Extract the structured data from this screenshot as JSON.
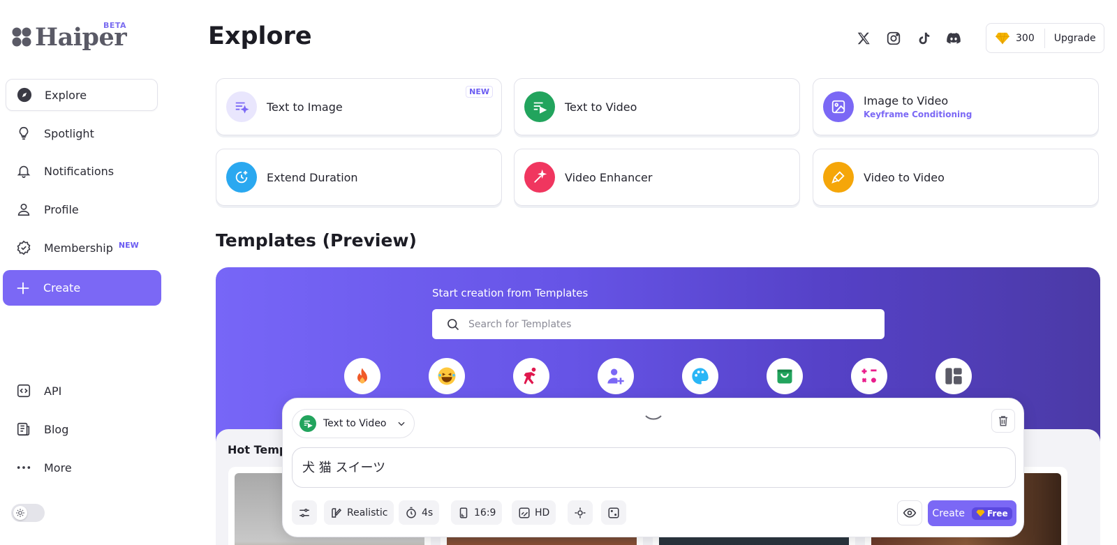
{
  "app": {
    "logo_text": "Haiper",
    "beta_label": "BETA"
  },
  "sidebar": {
    "items": [
      {
        "label": "Explore",
        "icon": "compass-icon"
      },
      {
        "label": "Spotlight",
        "icon": "lightbulb-icon"
      },
      {
        "label": "Notifications",
        "icon": "bell-icon"
      },
      {
        "label": "Profile",
        "icon": "user-icon"
      },
      {
        "label": "Membership",
        "icon": "badge-check-icon",
        "badge": "NEW"
      }
    ],
    "create_label": "Create",
    "bottom_items": [
      {
        "label": "API",
        "icon": "code-icon"
      },
      {
        "label": "Blog",
        "icon": "newspaper-icon"
      },
      {
        "label": "More",
        "icon": "dots-icon"
      }
    ]
  },
  "header": {
    "title": "Explore",
    "socials": [
      "x-icon",
      "instagram-icon",
      "tiktok-icon",
      "discord-icon"
    ],
    "credits": "300",
    "upgrade_label": "Upgrade"
  },
  "tools": [
    {
      "label": "Text to Image",
      "badge": "NEW",
      "color": "#e9e6fd"
    },
    {
      "label": "Text to Video",
      "color": "#22a45d"
    },
    {
      "label": "Image to Video",
      "sub": "Keyframe Conditioning",
      "color": "#7b68f5"
    },
    {
      "label": "Extend Duration",
      "color": "#2aa8f0"
    },
    {
      "label": "Video Enhancer",
      "color": "#f0365f"
    },
    {
      "label": "Video to Video",
      "color": "#f5a609"
    }
  ],
  "templates": {
    "title": "Templates (Preview)",
    "banner_label": "Start creation from Templates",
    "search_placeholder": "Search for Templates",
    "categories": [
      "fire-icon",
      "laughing-emoji-icon",
      "dancing-person-icon",
      "user-plus-icon",
      "palette-icon",
      "shopping-bag-icon",
      "shapes-icon",
      "layout-icon"
    ],
    "hot_title": "Hot Templ"
  },
  "composer": {
    "mode_label": "Text to Video",
    "prompt": "犬 猫 スイーツ",
    "chips": {
      "style": "Realistic",
      "duration": "4s",
      "ratio": "16:9",
      "quality": "HD"
    },
    "create_label": "Create",
    "free_label": "Free"
  }
}
